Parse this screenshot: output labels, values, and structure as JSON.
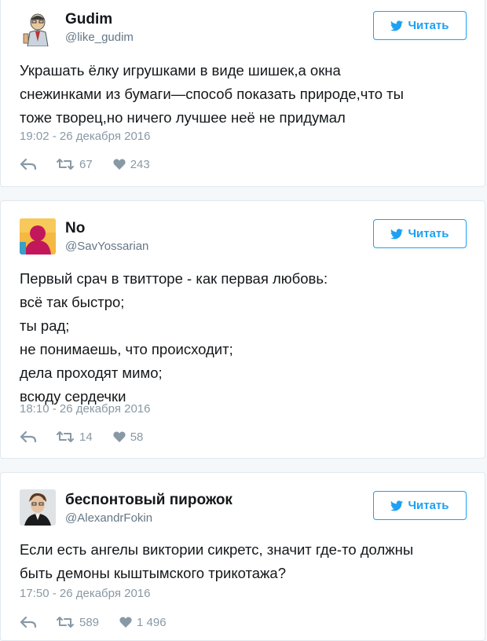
{
  "tweets": [
    {
      "name": "Gudim",
      "handle": "@like_gudim",
      "follow_label": "Читать",
      "lines": [
        "Украшать ёлку игрушками в виде шишек,а окна",
        "снежинками из бумаги—способ показать природе,что ты",
        "тоже творец,но ничего лучшее неё не придумал"
      ],
      "time": "19:02 - 26 декабря 2016",
      "retweets": "67",
      "likes": "243"
    },
    {
      "name": "No",
      "handle": "@SavYossarian",
      "follow_label": "Читать",
      "lines": [
        "Первый срач в твитторе - как первая любовь:",
        "всё так быстро;",
        "ты рад;",
        "не понимаешь, что происходит;",
        "дела проходят мимо;",
        "всюду сердечки"
      ],
      "time": "18:10 - 26 декабря 2016",
      "retweets": "14",
      "likes": "58"
    },
    {
      "name": "беспонтовый пирожок",
      "handle": "@AlexandrFokin",
      "follow_label": "Читать",
      "lines": [
        "Если есть ангелы виктории сикретс, значит где-то должны",
        "быть демоны кыштымского трикотажа?"
      ],
      "time": "17:50 - 26 декабря 2016",
      "retweets": "589",
      "likes": "1 496"
    }
  ],
  "colors": {
    "accent": "#1da1f2",
    "muted": "#8899a6",
    "handle": "#657786",
    "text": "#14171a",
    "border": "#e1e8ed",
    "background": "#f5f8fa"
  },
  "icons": [
    "twitter-bird-icon",
    "reply-icon",
    "retweet-icon",
    "heart-icon"
  ]
}
